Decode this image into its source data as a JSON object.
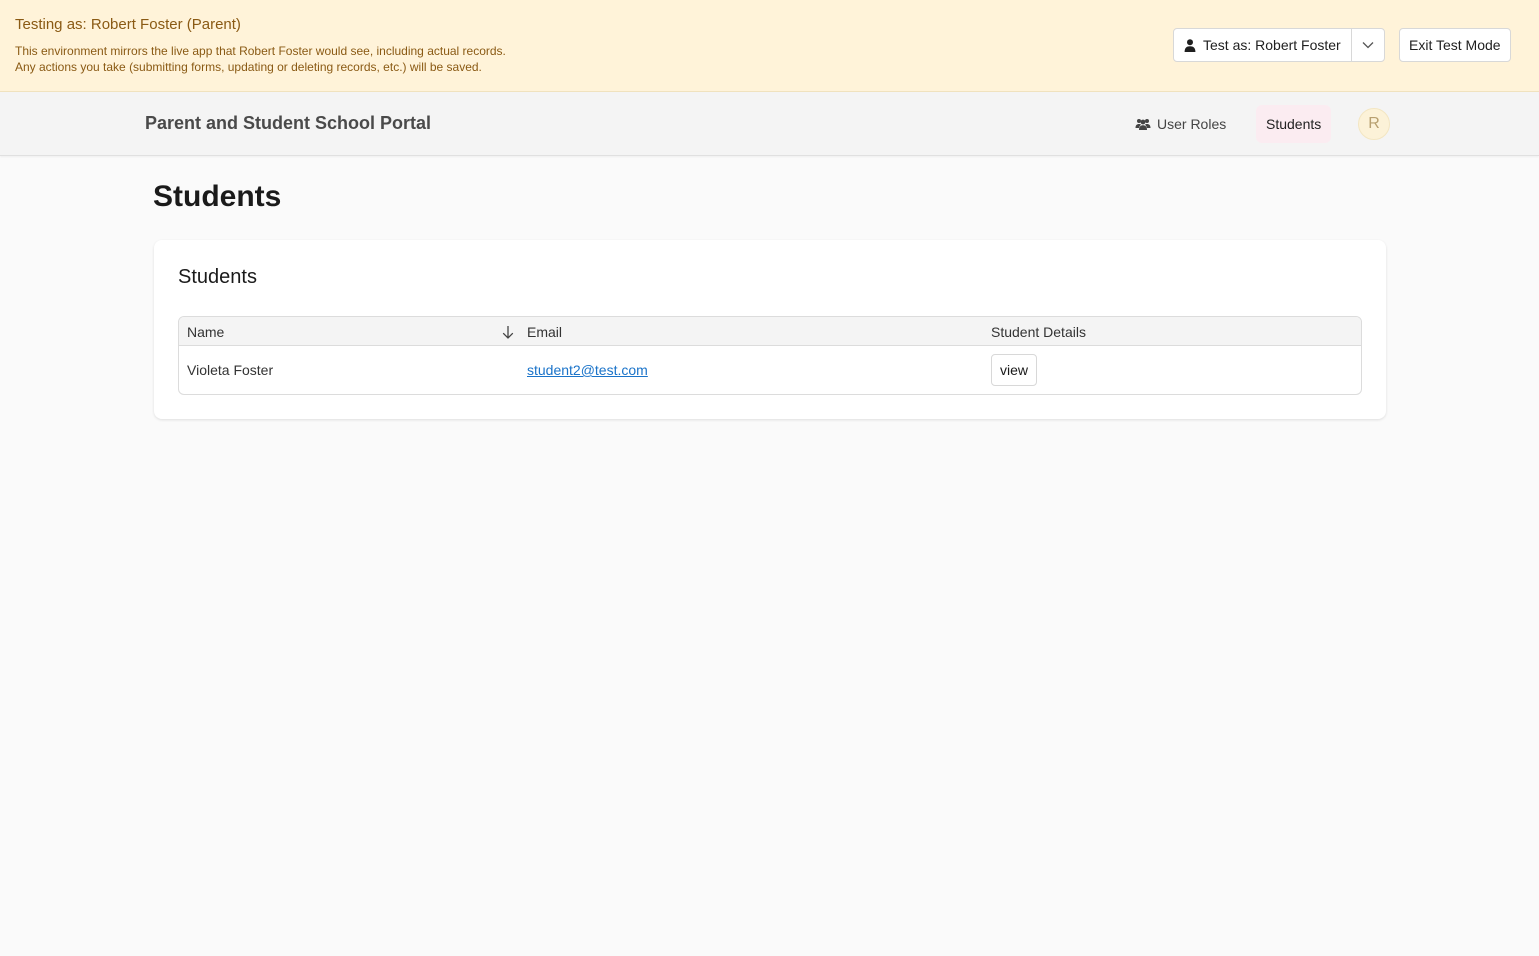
{
  "banner": {
    "title": "Testing as: Robert Foster (Parent)",
    "line1": "This environment mirrors the live app that Robert Foster would see, including actual records.",
    "line2": "Any actions you take (submitting forms, updating or deleting records, etc.) will be saved.",
    "test_as_label": "Test as: Robert Foster",
    "exit_label": "Exit Test Mode",
    "colors": {
      "background": "#fff3d9",
      "text": "#8a5a14"
    }
  },
  "header": {
    "app_title": "Parent and Student School Portal",
    "nav": [
      {
        "label": "User Roles",
        "icon": "users-icon"
      },
      {
        "label": "Students",
        "active": true
      }
    ],
    "avatar_initial": "R"
  },
  "main": {
    "page_title": "Students",
    "card_title": "Students",
    "table": {
      "columns": [
        "Name",
        "Email",
        "Student Details"
      ],
      "sort_icon": "arrow-down-icon",
      "rows": [
        {
          "name": "Violeta Foster",
          "email": "student2@test.com",
          "action": "view"
        }
      ]
    }
  }
}
